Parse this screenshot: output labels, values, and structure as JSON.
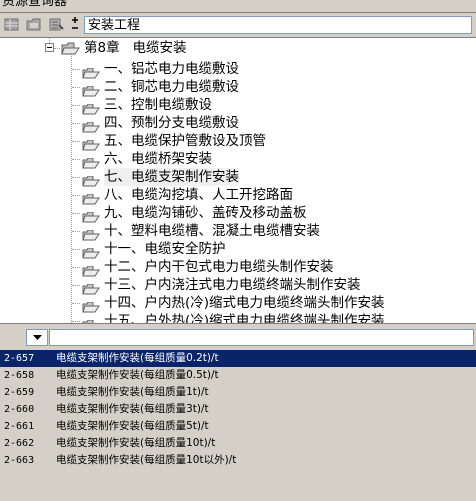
{
  "window": {
    "title": "资源查询器"
  },
  "toolbar": {
    "combo_value": "安装工程"
  },
  "tree": {
    "chapter": {
      "label": "第8章   电缆安装"
    },
    "items": [
      {
        "label": "一、铝芯电力电缆敷设"
      },
      {
        "label": "二、铜芯电力电缆敷设"
      },
      {
        "label": "三、控制电缆敷设"
      },
      {
        "label": "四、预制分支电缆敷设"
      },
      {
        "label": "五、电缆保护管敷设及顶管"
      },
      {
        "label": "六、电缆桥架安装"
      },
      {
        "label": "七、电缆支架制作安装"
      },
      {
        "label": "八、电缆沟挖填、人工开挖路面"
      },
      {
        "label": "九、电缆沟铺砂、盖砖及移动盖板"
      },
      {
        "label": "十、塑料电缆槽、混凝土电缆槽安装"
      },
      {
        "label": "十一、电缆安全防护"
      },
      {
        "label": "十二、户内干包式电力电缆头制作安装"
      },
      {
        "label": "十三、户内浇注式电力电缆终端头制作安装"
      },
      {
        "label": "十四、户内热(冷)缩式电力电缆终端头制作安装"
      },
      {
        "label": "十五、户外热(冷)缩式电力电缆终端头制作安装"
      }
    ]
  },
  "results": [
    {
      "code": "2-657",
      "name": "电缆支架制作安装(每组质量0.2t)/t"
    },
    {
      "code": "2-658",
      "name": "电缆支架制作安装(每组质量0.5t)/t"
    },
    {
      "code": "2-659",
      "name": "电缆支架制作安装(每组质量1t)/t"
    },
    {
      "code": "2-660",
      "name": "电缆支架制作安装(每组质量3t)/t"
    },
    {
      "code": "2-661",
      "name": "电缆支架制作安装(每组质量5t)/t"
    },
    {
      "code": "2-662",
      "name": "电缆支架制作安装(每组质量10t)/t"
    },
    {
      "code": "2-663",
      "name": "电缆支架制作安装(每组质量10t以外)/t"
    }
  ],
  "colors": {
    "selection": "#0a246a",
    "panel": "#d4d0c8"
  }
}
